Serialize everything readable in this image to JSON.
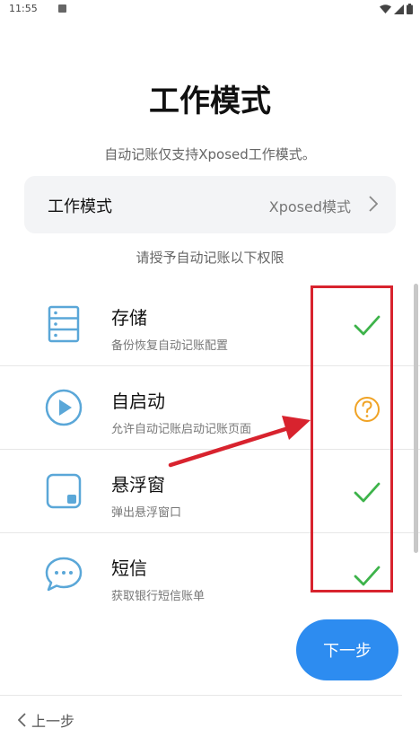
{
  "status_bar": {
    "time": "11:55"
  },
  "header": {
    "title": "工作模式",
    "subtitle": "自动记账仅支持Xposed工作模式。"
  },
  "mode_card": {
    "label": "工作模式",
    "value": "Xposed模式"
  },
  "permissions": {
    "hint": "请授予自动记账以下权限",
    "items": [
      {
        "name": "存储",
        "desc": "备份恢复自动记账配置",
        "icon": "storage-icon",
        "status": "granted"
      },
      {
        "name": "自启动",
        "desc": "允许自动记账启动记账页面",
        "icon": "play-icon",
        "status": "unknown"
      },
      {
        "name": "悬浮窗",
        "desc": "弹出悬浮窗口",
        "icon": "floating-window-icon",
        "status": "granted"
      },
      {
        "name": "短信",
        "desc": "获取银行短信账单",
        "icon": "chat-bubble-icon",
        "status": "granted"
      }
    ]
  },
  "footer": {
    "next_label": "下一步",
    "back_label": "上一步"
  },
  "colors": {
    "accent": "#2d8cf0",
    "icon_blue": "#5aa7d8",
    "granted_green": "#3db34a",
    "unknown_orange": "#f0a325",
    "annotation_red": "#d8232e"
  }
}
